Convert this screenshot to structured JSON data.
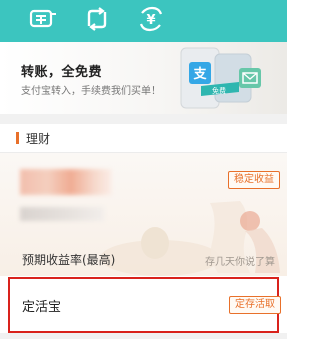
{
  "top_bar": {
    "icons": [
      {
        "name": "transfer-receipt-icon"
      },
      {
        "name": "exchange-icon"
      },
      {
        "name": "yuan-transfer-icon"
      }
    ],
    "color": "#3cc5bf"
  },
  "promo": {
    "title": "转账，全免费",
    "subtitle": "支付宝转入，手续费我们买单！",
    "card_label_free": "免费",
    "card_label_pay": "支"
  },
  "section": {
    "title": "理财",
    "accent": "#e8702a"
  },
  "product_card": {
    "tag": "稳定收益",
    "rate_label": "预期收益率(最高)",
    "slogan": "存几天你说了算"
  },
  "product_item": {
    "name": "定活宝",
    "tag": "定存活取",
    "highlight_color": "#d9221c"
  }
}
